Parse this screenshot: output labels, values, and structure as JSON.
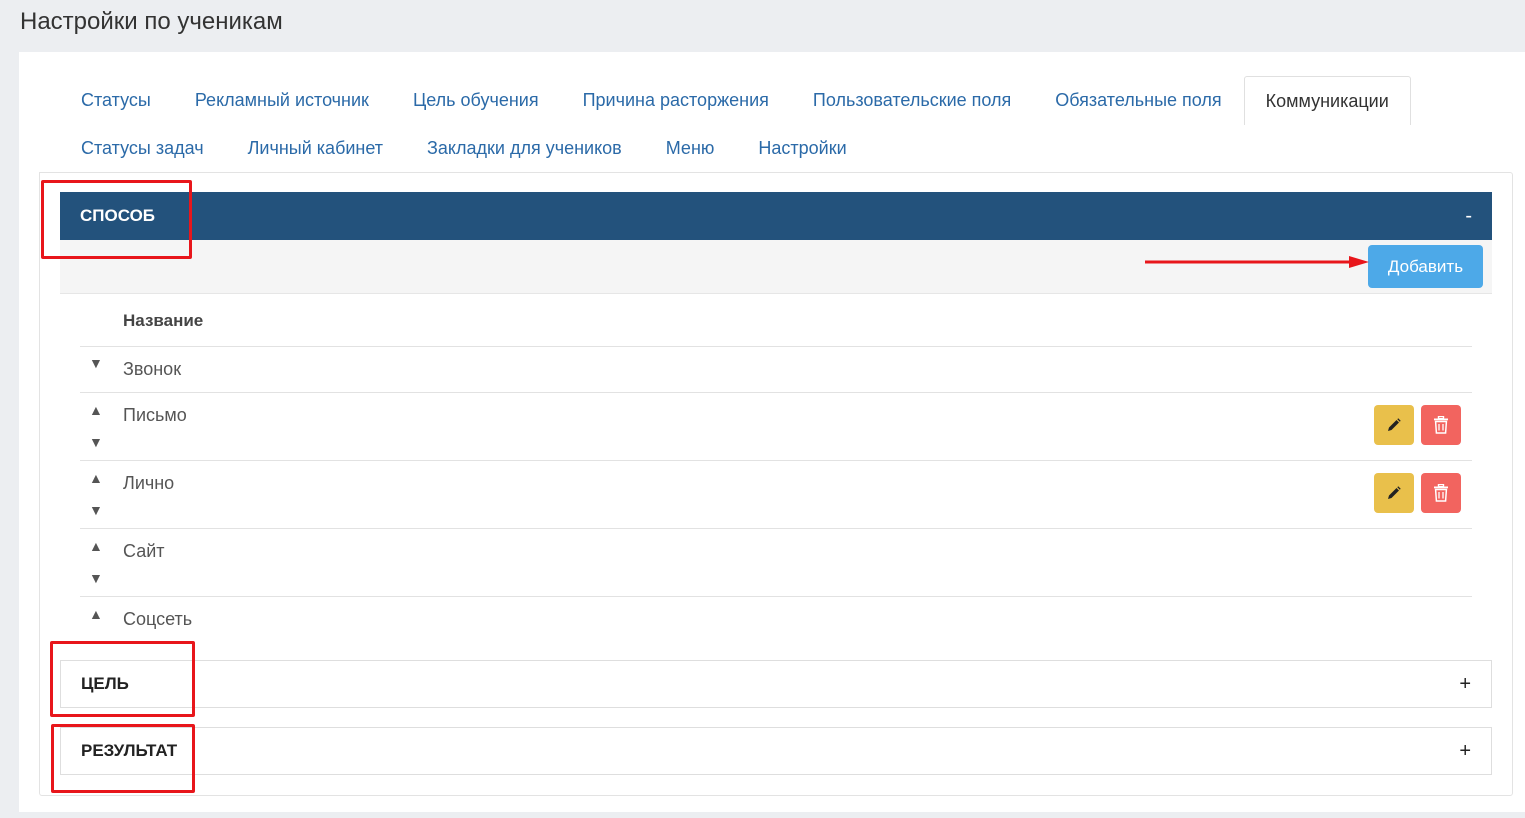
{
  "page": {
    "title": "Настройки по ученикам"
  },
  "tabs": {
    "row1": [
      {
        "label": "Статусы",
        "active": false
      },
      {
        "label": "Рекламный источник",
        "active": false
      },
      {
        "label": "Цель обучения",
        "active": false
      },
      {
        "label": "Причина расторжения",
        "active": false
      },
      {
        "label": "Пользовательские поля",
        "active": false
      },
      {
        "label": "Обязательные поля",
        "active": false
      },
      {
        "label": "Коммуникации",
        "active": true
      }
    ],
    "row2": [
      {
        "label": "Статусы задач",
        "active": false
      },
      {
        "label": "Личный кабинет",
        "active": false
      },
      {
        "label": "Закладки для учеников",
        "active": false
      },
      {
        "label": "Меню",
        "active": false
      },
      {
        "label": "Настройки",
        "active": false
      }
    ]
  },
  "panels": {
    "method": {
      "title": "СПОСОБ",
      "toggle": "-"
    },
    "goal": {
      "title": "ЦЕЛЬ",
      "toggle": "+"
    },
    "result": {
      "title": "РЕЗУЛЬТАТ",
      "toggle": "+"
    }
  },
  "toolbar": {
    "add_label": "Добавить"
  },
  "list": {
    "header": "Название",
    "items": [
      {
        "name": "Звонок"
      },
      {
        "name": "Письмо"
      },
      {
        "name": "Лично"
      },
      {
        "name": "Сайт"
      },
      {
        "name": "Соцсеть"
      }
    ]
  },
  "icons": {
    "up": "▲",
    "down": "▼",
    "edit": "pencil-icon",
    "delete": "trash-icon"
  },
  "colors": {
    "panel_header": "#23527c",
    "tab_link": "#2b6aa8",
    "add_button": "#4da9e8",
    "edit_button": "#e9c04b",
    "delete_button": "#f2645f",
    "annotation": "#e8161b"
  }
}
